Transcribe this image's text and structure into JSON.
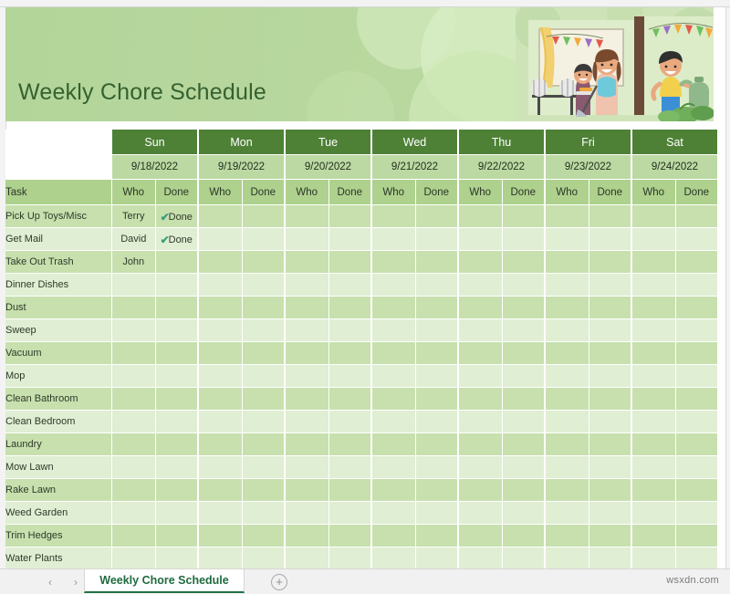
{
  "banner": {
    "title": "Weekly Chore Schedule",
    "illustration_name": "family-doing-chores-illustration",
    "background_color": "#b7d79e",
    "title_color": "#36612f"
  },
  "table": {
    "task_column_header": "Task",
    "sub_headers": [
      "Who",
      "Done"
    ],
    "header_color": "#4e8136",
    "date_row_color": "#bcd9a3",
    "label_row_color": "#aed18e",
    "row_odd_color": "#c7e0ae",
    "row_even_color": "#e0eed3",
    "check_color": "#3f9c7a",
    "days": [
      {
        "name": "Sun",
        "date": "9/18/2022"
      },
      {
        "name": "Mon",
        "date": "9/19/2022"
      },
      {
        "name": "Tue",
        "date": "9/20/2022"
      },
      {
        "name": "Wed",
        "date": "9/21/2022"
      },
      {
        "name": "Thu",
        "date": "9/22/2022"
      },
      {
        "name": "Fri",
        "date": "9/23/2022"
      },
      {
        "name": "Sat",
        "date": "9/24/2022"
      }
    ],
    "rows": [
      {
        "task": "Pick Up Toys/Misc",
        "cells": [
          {
            "who": "Terry",
            "done": "Done",
            "checked": true
          },
          {
            "who": "",
            "done": "",
            "checked": false
          },
          {
            "who": "",
            "done": "",
            "checked": false
          },
          {
            "who": "",
            "done": "",
            "checked": false
          },
          {
            "who": "",
            "done": "",
            "checked": false
          },
          {
            "who": "",
            "done": "",
            "checked": false
          },
          {
            "who": "",
            "done": "",
            "checked": false
          }
        ]
      },
      {
        "task": "Get Mail",
        "cells": [
          {
            "who": "David",
            "done": "Done",
            "checked": true
          },
          {
            "who": "",
            "done": "",
            "checked": false
          },
          {
            "who": "",
            "done": "",
            "checked": false
          },
          {
            "who": "",
            "done": "",
            "checked": false
          },
          {
            "who": "",
            "done": "",
            "checked": false
          },
          {
            "who": "",
            "done": "",
            "checked": false
          },
          {
            "who": "",
            "done": "",
            "checked": false
          }
        ]
      },
      {
        "task": "Take Out Trash",
        "cells": [
          {
            "who": "John",
            "done": "",
            "checked": false
          },
          {
            "who": "",
            "done": "",
            "checked": false
          },
          {
            "who": "",
            "done": "",
            "checked": false
          },
          {
            "who": "",
            "done": "",
            "checked": false
          },
          {
            "who": "",
            "done": "",
            "checked": false
          },
          {
            "who": "",
            "done": "",
            "checked": false
          },
          {
            "who": "",
            "done": "",
            "checked": false
          }
        ]
      },
      {
        "task": "Dinner Dishes",
        "cells": [
          {
            "who": "",
            "done": "",
            "checked": false
          },
          {
            "who": "",
            "done": "",
            "checked": false
          },
          {
            "who": "",
            "done": "",
            "checked": false
          },
          {
            "who": "",
            "done": "",
            "checked": false
          },
          {
            "who": "",
            "done": "",
            "checked": false
          },
          {
            "who": "",
            "done": "",
            "checked": false
          },
          {
            "who": "",
            "done": "",
            "checked": false
          }
        ]
      },
      {
        "task": "Dust",
        "cells": [
          {
            "who": "",
            "done": "",
            "checked": false
          },
          {
            "who": "",
            "done": "",
            "checked": false
          },
          {
            "who": "",
            "done": "",
            "checked": false
          },
          {
            "who": "",
            "done": "",
            "checked": false
          },
          {
            "who": "",
            "done": "",
            "checked": false
          },
          {
            "who": "",
            "done": "",
            "checked": false
          },
          {
            "who": "",
            "done": "",
            "checked": false
          }
        ]
      },
      {
        "task": "Sweep",
        "cells": [
          {
            "who": "",
            "done": "",
            "checked": false
          },
          {
            "who": "",
            "done": "",
            "checked": false
          },
          {
            "who": "",
            "done": "",
            "checked": false
          },
          {
            "who": "",
            "done": "",
            "checked": false
          },
          {
            "who": "",
            "done": "",
            "checked": false
          },
          {
            "who": "",
            "done": "",
            "checked": false
          },
          {
            "who": "",
            "done": "",
            "checked": false
          }
        ]
      },
      {
        "task": "Vacuum",
        "cells": [
          {
            "who": "",
            "done": "",
            "checked": false
          },
          {
            "who": "",
            "done": "",
            "checked": false
          },
          {
            "who": "",
            "done": "",
            "checked": false
          },
          {
            "who": "",
            "done": "",
            "checked": false
          },
          {
            "who": "",
            "done": "",
            "checked": false
          },
          {
            "who": "",
            "done": "",
            "checked": false
          },
          {
            "who": "",
            "done": "",
            "checked": false
          }
        ]
      },
      {
        "task": "Mop",
        "cells": [
          {
            "who": "",
            "done": "",
            "checked": false
          },
          {
            "who": "",
            "done": "",
            "checked": false
          },
          {
            "who": "",
            "done": "",
            "checked": false
          },
          {
            "who": "",
            "done": "",
            "checked": false
          },
          {
            "who": "",
            "done": "",
            "checked": false
          },
          {
            "who": "",
            "done": "",
            "checked": false
          },
          {
            "who": "",
            "done": "",
            "checked": false
          }
        ]
      },
      {
        "task": "Clean Bathroom",
        "cells": [
          {
            "who": "",
            "done": "",
            "checked": false
          },
          {
            "who": "",
            "done": "",
            "checked": false
          },
          {
            "who": "",
            "done": "",
            "checked": false
          },
          {
            "who": "",
            "done": "",
            "checked": false
          },
          {
            "who": "",
            "done": "",
            "checked": false
          },
          {
            "who": "",
            "done": "",
            "checked": false
          },
          {
            "who": "",
            "done": "",
            "checked": false
          }
        ]
      },
      {
        "task": "Clean Bedroom",
        "cells": [
          {
            "who": "",
            "done": "",
            "checked": false
          },
          {
            "who": "",
            "done": "",
            "checked": false
          },
          {
            "who": "",
            "done": "",
            "checked": false
          },
          {
            "who": "",
            "done": "",
            "checked": false
          },
          {
            "who": "",
            "done": "",
            "checked": false
          },
          {
            "who": "",
            "done": "",
            "checked": false
          },
          {
            "who": "",
            "done": "",
            "checked": false
          }
        ]
      },
      {
        "task": "Laundry",
        "cells": [
          {
            "who": "",
            "done": "",
            "checked": false
          },
          {
            "who": "",
            "done": "",
            "checked": false
          },
          {
            "who": "",
            "done": "",
            "checked": false
          },
          {
            "who": "",
            "done": "",
            "checked": false
          },
          {
            "who": "",
            "done": "",
            "checked": false
          },
          {
            "who": "",
            "done": "",
            "checked": false
          },
          {
            "who": "",
            "done": "",
            "checked": false
          }
        ]
      },
      {
        "task": "Mow Lawn",
        "cells": [
          {
            "who": "",
            "done": "",
            "checked": false
          },
          {
            "who": "",
            "done": "",
            "checked": false
          },
          {
            "who": "",
            "done": "",
            "checked": false
          },
          {
            "who": "",
            "done": "",
            "checked": false
          },
          {
            "who": "",
            "done": "",
            "checked": false
          },
          {
            "who": "",
            "done": "",
            "checked": false
          },
          {
            "who": "",
            "done": "",
            "checked": false
          }
        ]
      },
      {
        "task": "Rake Lawn",
        "cells": [
          {
            "who": "",
            "done": "",
            "checked": false
          },
          {
            "who": "",
            "done": "",
            "checked": false
          },
          {
            "who": "",
            "done": "",
            "checked": false
          },
          {
            "who": "",
            "done": "",
            "checked": false
          },
          {
            "who": "",
            "done": "",
            "checked": false
          },
          {
            "who": "",
            "done": "",
            "checked": false
          },
          {
            "who": "",
            "done": "",
            "checked": false
          }
        ]
      },
      {
        "task": "Weed Garden",
        "cells": [
          {
            "who": "",
            "done": "",
            "checked": false
          },
          {
            "who": "",
            "done": "",
            "checked": false
          },
          {
            "who": "",
            "done": "",
            "checked": false
          },
          {
            "who": "",
            "done": "",
            "checked": false
          },
          {
            "who": "",
            "done": "",
            "checked": false
          },
          {
            "who": "",
            "done": "",
            "checked": false
          },
          {
            "who": "",
            "done": "",
            "checked": false
          }
        ]
      },
      {
        "task": "Trim Hedges",
        "cells": [
          {
            "who": "",
            "done": "",
            "checked": false
          },
          {
            "who": "",
            "done": "",
            "checked": false
          },
          {
            "who": "",
            "done": "",
            "checked": false
          },
          {
            "who": "",
            "done": "",
            "checked": false
          },
          {
            "who": "",
            "done": "",
            "checked": false
          },
          {
            "who": "",
            "done": "",
            "checked": false
          },
          {
            "who": "",
            "done": "",
            "checked": false
          }
        ]
      },
      {
        "task": "Water Plants",
        "cells": [
          {
            "who": "",
            "done": "",
            "checked": false
          },
          {
            "who": "",
            "done": "",
            "checked": false
          },
          {
            "who": "",
            "done": "",
            "checked": false
          },
          {
            "who": "",
            "done": "",
            "checked": false
          },
          {
            "who": "",
            "done": "",
            "checked": false
          },
          {
            "who": "",
            "done": "",
            "checked": false
          },
          {
            "who": "",
            "done": "",
            "checked": false
          }
        ]
      }
    ]
  },
  "sheet_bar": {
    "prev_arrow": "‹",
    "next_arrow": "›",
    "active_tab": "Weekly Chore Schedule",
    "add_sheet_label": "+",
    "watermark": "wsxdn.com"
  }
}
